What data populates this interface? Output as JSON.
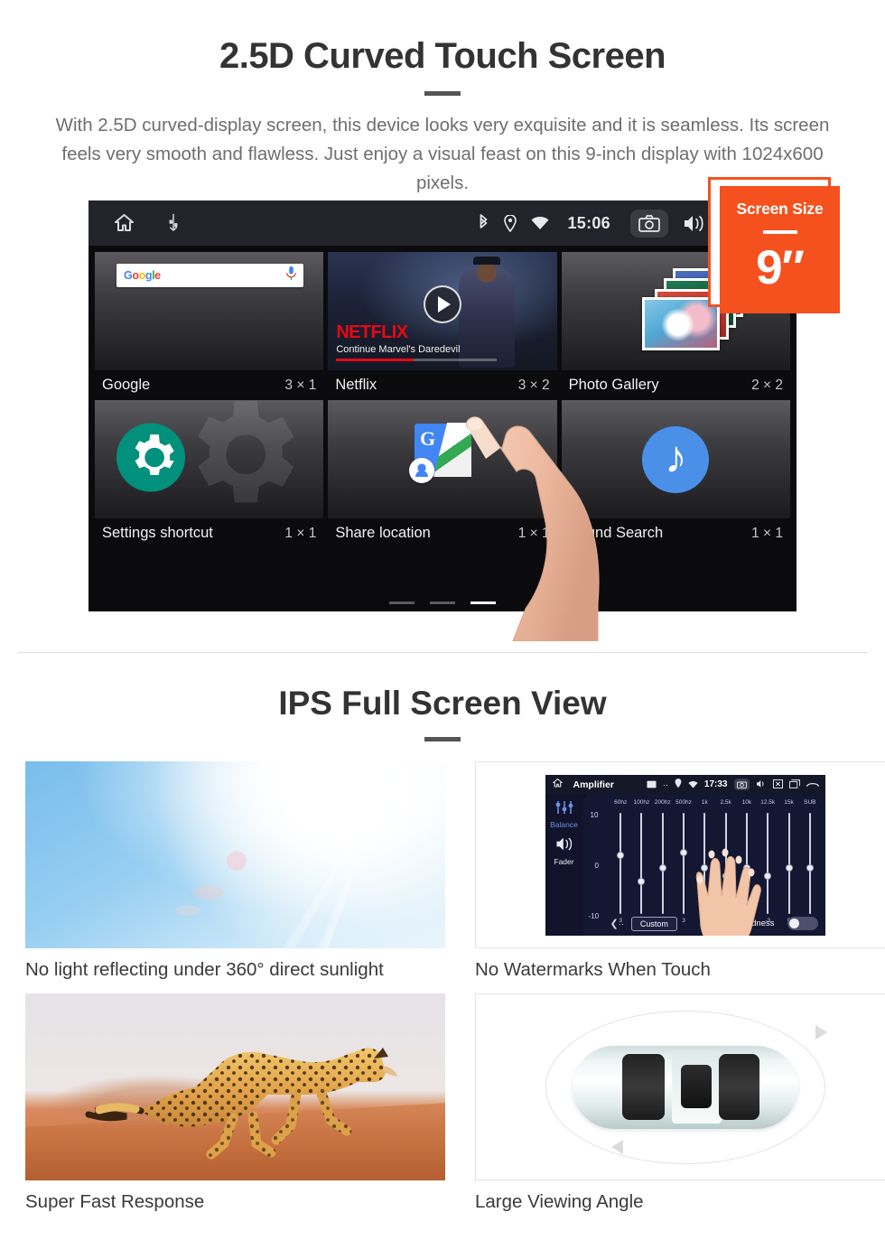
{
  "section1": {
    "title": "2.5D Curved Touch Screen",
    "description": "With 2.5D curved-display screen, this device looks very exquisite and it is seamless. Its screen feels very smooth and flawless. Just enjoy a visual feast on this 9-inch display with 1024x600 pixels."
  },
  "badge": {
    "title": "Screen Size",
    "value": "9″"
  },
  "android_screen": {
    "statusbar": {
      "clock": "15:06",
      "left_icons": [
        "home-icon",
        "usb-icon"
      ],
      "right_icons": [
        "bluetooth-icon",
        "location-icon",
        "wifi-icon",
        "camera-icon",
        "volume-icon",
        "close-icon",
        "recents-icon"
      ]
    },
    "widgets": [
      {
        "name": "Google",
        "size": "3 × 1",
        "icon": "google-search-widget",
        "search_placeholder": "Google"
      },
      {
        "name": "Netflix",
        "size": "3 × 2",
        "icon": "netflix-widget",
        "logo": "NETFLIX",
        "subtitle": "Continue Marvel's Daredevil"
      },
      {
        "name": "Photo Gallery",
        "size": "2 × 2",
        "icon": "photo-gallery-widget"
      },
      {
        "name": "Settings shortcut",
        "size": "1 × 1",
        "icon": "gear-icon"
      },
      {
        "name": "Share location",
        "size": "1 × 1",
        "icon": "google-maps-icon"
      },
      {
        "name": "Sound Search",
        "size": "1 × 1",
        "icon": "music-note-icon"
      }
    ],
    "page_indicator": {
      "count": 3,
      "active": 3
    }
  },
  "section2": {
    "title": "IPS Full Screen View",
    "cards": [
      {
        "caption": "No light reflecting under 360° direct sunlight",
        "image": "blue-sky-sun-flare"
      },
      {
        "caption": "No Watermarks When Touch",
        "image": "amplifier-equalizer-screen"
      },
      {
        "caption": "Super Fast Response",
        "image": "running-cheetah"
      },
      {
        "caption": "Large Viewing Angle",
        "image": "car-top-view-rotation"
      }
    ]
  },
  "amplifier": {
    "title": "Amplifier",
    "time": "17:33",
    "side_controls": [
      {
        "label": "Balance",
        "icon": "equalizer-sliders-icon"
      },
      {
        "label": "Fader",
        "icon": "speaker-icon"
      }
    ],
    "scale": {
      "top": "10",
      "mid": "0",
      "bottom": "-10"
    },
    "bands": [
      "60hz",
      "100hz",
      "200hz",
      "500hz",
      "1k",
      "2.5k",
      "10k",
      "12.5k",
      "15k",
      "SUB"
    ],
    "values": [
      "3",
      "-4",
      "0",
      "3",
      "0",
      "-3",
      "0",
      "-3",
      "0",
      "0"
    ],
    "preset_button": "Custom",
    "loudness_label": "loudness",
    "loudness_on": false,
    "back_icon": "back-arrow-icon"
  },
  "colors": {
    "accent_orange": "#F4511E",
    "title_dark": "#333333",
    "body_gray": "#6e6e6e",
    "netflix_red": "#E50914"
  }
}
